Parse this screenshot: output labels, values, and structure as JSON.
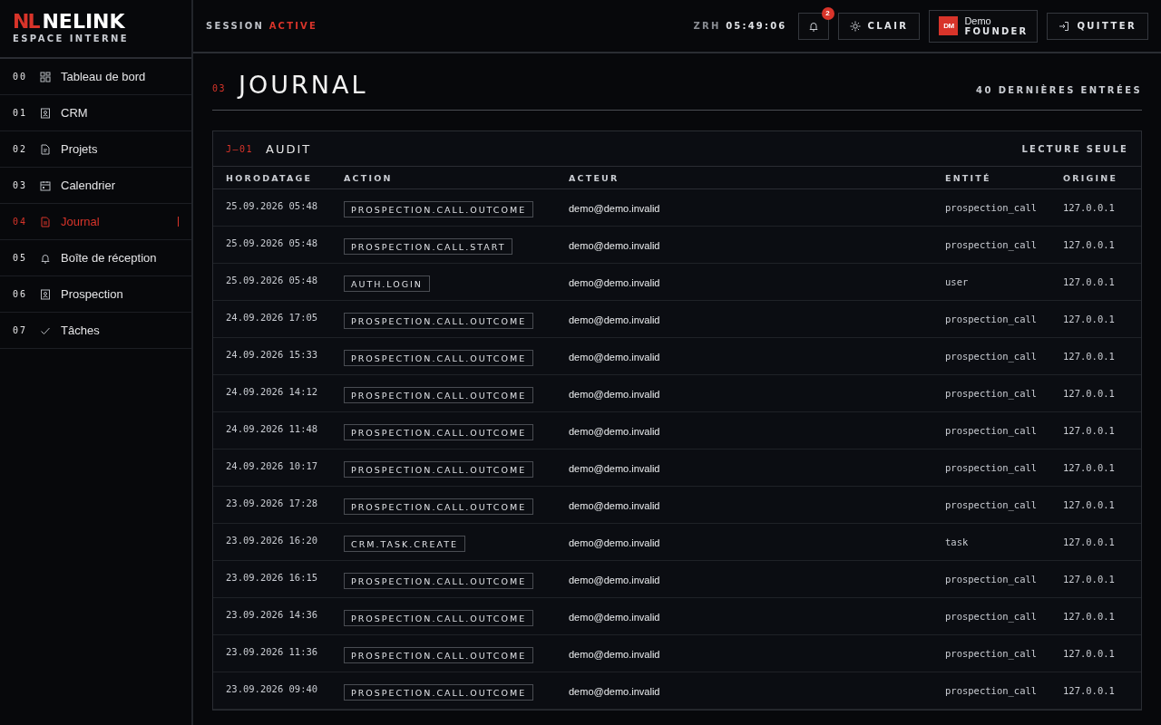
{
  "brand": {
    "mark": "NL",
    "name": "NELINK",
    "subtitle": "ESPACE INTERNE"
  },
  "sidebar": {
    "items": [
      {
        "number": "00",
        "label": "Tableau de bord",
        "kind": "grid",
        "selected": false
      },
      {
        "number": "01",
        "label": "CRM",
        "kind": "contact",
        "selected": false
      },
      {
        "number": "02",
        "label": "Projets",
        "kind": "project",
        "selected": false
      },
      {
        "number": "03",
        "label": "Calendrier",
        "kind": "calendar",
        "selected": false
      },
      {
        "number": "04",
        "label": "Journal",
        "kind": "file",
        "selected": true
      },
      {
        "number": "05",
        "label": "Boîte de réception",
        "kind": "bell",
        "selected": false
      },
      {
        "number": "06",
        "label": "Prospection",
        "kind": "contact",
        "selected": false
      },
      {
        "number": "07",
        "label": "Tâches",
        "kind": "check",
        "selected": false
      }
    ]
  },
  "header": {
    "session_label": "SESSION",
    "session_status": "ACTIVE",
    "clock_zone": "ZRH",
    "clock_time": "05:49:06",
    "notifications": "2",
    "theme_button": "CLAIR",
    "user_initials": "DM",
    "user_name": "Demo",
    "user_role": "FOUNDER",
    "logout_button": "QUITTER"
  },
  "page": {
    "number": "03",
    "title": "JOURNAL",
    "count": "40 DERNIÈRES ENTRÉES"
  },
  "panel": {
    "code": "J—01",
    "title": "AUDIT",
    "mode": "LECTURE SEULE"
  },
  "table": {
    "columns": [
      "HORODATAGE",
      "ACTION",
      "ACTEUR",
      "ENTITÉ",
      "ORIGINE"
    ],
    "rows": [
      [
        "25.09.2026 05:48",
        "PROSPECTION.CALL.OUTCOME",
        "demo@demo.invalid",
        "prospection_call",
        "127.0.0.1"
      ],
      [
        "25.09.2026 05:48",
        "PROSPECTION.CALL.START",
        "demo@demo.invalid",
        "prospection_call",
        "127.0.0.1"
      ],
      [
        "25.09.2026 05:48",
        "AUTH.LOGIN",
        "demo@demo.invalid",
        "user",
        "127.0.0.1"
      ],
      [
        "24.09.2026 17:05",
        "PROSPECTION.CALL.OUTCOME",
        "demo@demo.invalid",
        "prospection_call",
        "127.0.0.1"
      ],
      [
        "24.09.2026 15:33",
        "PROSPECTION.CALL.OUTCOME",
        "demo@demo.invalid",
        "prospection_call",
        "127.0.0.1"
      ],
      [
        "24.09.2026 14:12",
        "PROSPECTION.CALL.OUTCOME",
        "demo@demo.invalid",
        "prospection_call",
        "127.0.0.1"
      ],
      [
        "24.09.2026 11:48",
        "PROSPECTION.CALL.OUTCOME",
        "demo@demo.invalid",
        "prospection_call",
        "127.0.0.1"
      ],
      [
        "24.09.2026 10:17",
        "PROSPECTION.CALL.OUTCOME",
        "demo@demo.invalid",
        "prospection_call",
        "127.0.0.1"
      ],
      [
        "23.09.2026 17:28",
        "PROSPECTION.CALL.OUTCOME",
        "demo@demo.invalid",
        "prospection_call",
        "127.0.0.1"
      ],
      [
        "23.09.2026 16:20",
        "CRM.TASK.CREATE",
        "demo@demo.invalid",
        "task",
        "127.0.0.1"
      ],
      [
        "23.09.2026 16:15",
        "PROSPECTION.CALL.OUTCOME",
        "demo@demo.invalid",
        "prospection_call",
        "127.0.0.1"
      ],
      [
        "23.09.2026 14:36",
        "PROSPECTION.CALL.OUTCOME",
        "demo@demo.invalid",
        "prospection_call",
        "127.0.0.1"
      ],
      [
        "23.09.2026 11:36",
        "PROSPECTION.CALL.OUTCOME",
        "demo@demo.invalid",
        "prospection_call",
        "127.0.0.1"
      ],
      [
        "23.09.2026 09:40",
        "PROSPECTION.CALL.OUTCOME",
        "demo@demo.invalid",
        "prospection_call",
        "127.0.0.1"
      ]
    ]
  }
}
